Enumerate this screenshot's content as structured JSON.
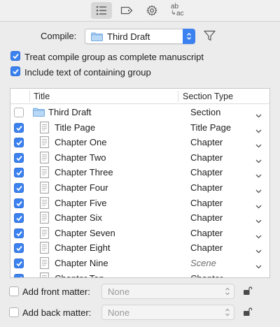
{
  "toolbar": {
    "tabs": [
      {
        "name": "contents",
        "active": true
      },
      {
        "name": "labels",
        "active": false
      },
      {
        "name": "options",
        "active": false
      },
      {
        "name": "replacements",
        "active": false
      }
    ],
    "replacement_glyph_top": "ab",
    "replacement_glyph_bottom": "ac"
  },
  "compile": {
    "label": "Compile:",
    "selected": "Third Draft"
  },
  "options": [
    {
      "label": "Treat compile group as complete manuscript",
      "checked": true
    },
    {
      "label": "Include text of containing group",
      "checked": true
    }
  ],
  "table": {
    "headers": {
      "title": "Title",
      "section_type": "Section Type"
    },
    "rows": [
      {
        "title": "Third Draft",
        "section_type": "Section",
        "checked": false,
        "kind": "folder",
        "italic": false
      },
      {
        "title": "Title Page",
        "section_type": "Title Page",
        "checked": true,
        "kind": "document",
        "italic": false
      },
      {
        "title": "Chapter One",
        "section_type": "Chapter",
        "checked": true,
        "kind": "document",
        "italic": false
      },
      {
        "title": "Chapter Two",
        "section_type": "Chapter",
        "checked": true,
        "kind": "document",
        "italic": false
      },
      {
        "title": "Chapter Three",
        "section_type": "Chapter",
        "checked": true,
        "kind": "document",
        "italic": false
      },
      {
        "title": "Chapter Four",
        "section_type": "Chapter",
        "checked": true,
        "kind": "document",
        "italic": false
      },
      {
        "title": "Chapter Five",
        "section_type": "Chapter",
        "checked": true,
        "kind": "document",
        "italic": false
      },
      {
        "title": "Chapter Six",
        "section_type": "Chapter",
        "checked": true,
        "kind": "document",
        "italic": false
      },
      {
        "title": "Chapter Seven",
        "section_type": "Chapter",
        "checked": true,
        "kind": "document",
        "italic": false
      },
      {
        "title": "Chapter Eight",
        "section_type": "Chapter",
        "checked": true,
        "kind": "document",
        "italic": false
      },
      {
        "title": "Chapter Nine",
        "section_type": "Scene",
        "checked": true,
        "kind": "document",
        "italic": true
      },
      {
        "title": "Chapter Ten",
        "section_type": "Chapter",
        "checked": true,
        "kind": "document",
        "italic": false
      }
    ]
  },
  "front_matter": {
    "label": "Add front matter:",
    "checked": false,
    "value": "None"
  },
  "back_matter": {
    "label": "Add back matter:",
    "checked": false,
    "value": "None"
  },
  "colors": {
    "accent": "#3b82f0",
    "folder": "#9cc4ee"
  }
}
